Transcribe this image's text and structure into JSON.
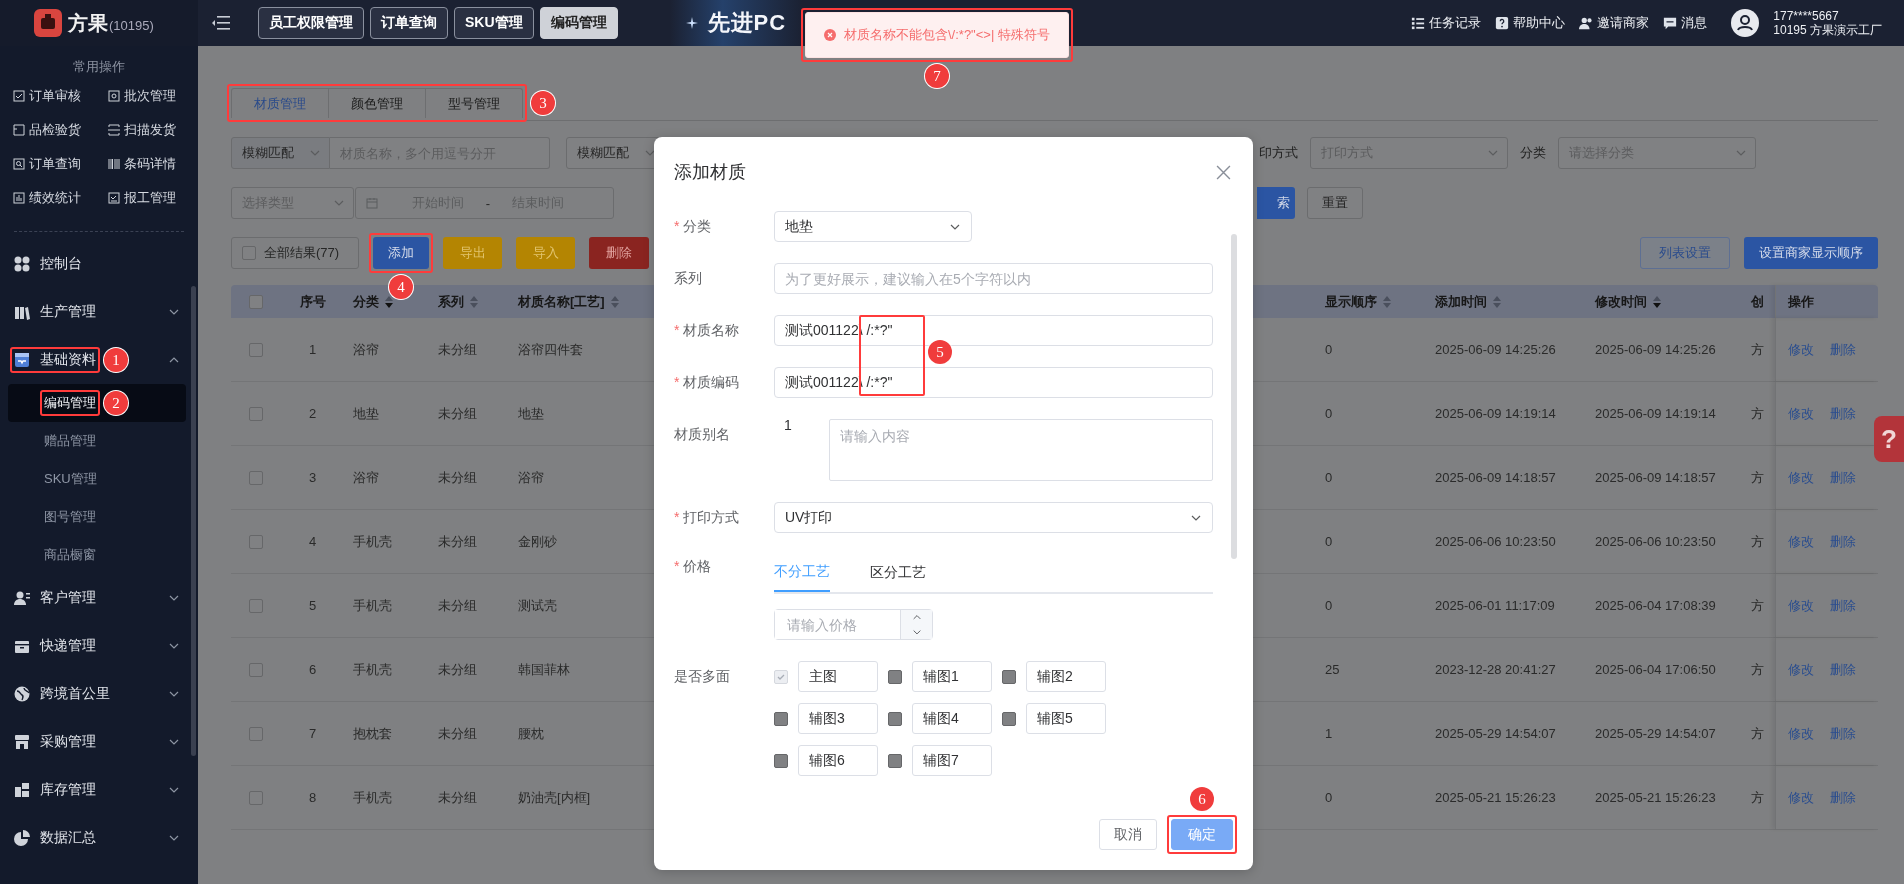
{
  "app": {
    "name": "方果",
    "id": "(10195)"
  },
  "topbar": {
    "nav": [
      {
        "label": "员工权限管理",
        "selected": false
      },
      {
        "label": "订单查询",
        "selected": false
      },
      {
        "label": "SKU管理",
        "selected": false
      },
      {
        "label": "编码管理",
        "selected": true
      }
    ],
    "banner_text": "先进PC",
    "tools": [
      {
        "label": "任务记录"
      },
      {
        "label": "帮助中心"
      },
      {
        "label": "邀请商家"
      },
      {
        "label": "消息"
      }
    ],
    "user": {
      "phone": "177****5667",
      "factory": "10195 方果演示工厂"
    }
  },
  "toast": {
    "message": "材质名称不能包含\\/:*?\"<>| 特殊符号",
    "annotation": "7"
  },
  "sidebar": {
    "quick_title": "常用操作",
    "quick_actions": [
      {
        "label": "订单审核"
      },
      {
        "label": "批次管理"
      },
      {
        "label": "品检验货"
      },
      {
        "label": "扫描发货"
      },
      {
        "label": "订单查询"
      },
      {
        "label": "条码详情"
      },
      {
        "label": "绩效统计"
      },
      {
        "label": "报工管理"
      }
    ],
    "menu": [
      {
        "label": "控制台"
      },
      {
        "label": "生产管理",
        "expanded": false
      },
      {
        "label": "基础资料",
        "expanded": true,
        "annotation": "1",
        "children": [
          {
            "label": "编码管理",
            "selected": true,
            "annotation": "2"
          },
          {
            "label": "赠品管理",
            "selected": false
          },
          {
            "label": "SKU管理",
            "selected": false
          },
          {
            "label": "图号管理",
            "selected": false
          },
          {
            "label": "商品橱窗",
            "selected": false
          }
        ]
      },
      {
        "label": "客户管理",
        "expanded": false
      },
      {
        "label": "快递管理",
        "expanded": false
      },
      {
        "label": "跨境首公里",
        "expanded": false
      },
      {
        "label": "采购管理",
        "expanded": false
      },
      {
        "label": "库存管理",
        "expanded": false
      },
      {
        "label": "数据汇总",
        "expanded": false
      }
    ]
  },
  "tabs": {
    "annotation": "3",
    "items": [
      {
        "label": "材质管理",
        "selected": true
      },
      {
        "label": "颜色管理",
        "selected": false
      },
      {
        "label": "型号管理",
        "selected": false
      }
    ]
  },
  "filters": {
    "match_select": "模糊匹配",
    "name_placeholder": "材质名称，多个用逗号分开",
    "match_select_2": "模糊匹配",
    "print_label": "印方式",
    "print_placeholder": "打印方式",
    "category_label": "分类",
    "category_placeholder": "请选择分类",
    "type_placeholder": "选择类型",
    "date_start": "开始时间",
    "date_separator": "-",
    "date_end": "结束时间",
    "search_button": "索",
    "reset_button": "重置"
  },
  "actions": {
    "all_results": {
      "label": "全部结果(77)",
      "checked": false
    },
    "buttons": [
      {
        "label": "添加",
        "kind": "primary",
        "annotation": "4"
      },
      {
        "label": "导出",
        "kind": "warning"
      },
      {
        "label": "导入",
        "kind": "warning"
      },
      {
        "label": "删除",
        "kind": "danger"
      }
    ],
    "right_buttons": [
      {
        "label": "列表设置",
        "kind": "plain"
      },
      {
        "label": "设置商家显示顺序",
        "kind": "primary"
      }
    ]
  },
  "table": {
    "header_checked": false,
    "columns": [
      {
        "label": "序号"
      },
      {
        "label": "分类",
        "sorted_desc": true
      },
      {
        "label": "系列",
        "sorted_desc": false
      },
      {
        "label": "材质名称[工艺]",
        "sorted_desc": false
      },
      {
        "label": "显示顺序",
        "sorted_desc": false
      },
      {
        "label": "添加时间",
        "sorted_desc": false
      },
      {
        "label": "修改时间",
        "sorted_desc": true
      },
      {
        "label": "创"
      },
      {
        "label": "操作"
      }
    ],
    "rows": [
      {
        "checked": false,
        "cells": [
          "1",
          "浴帘",
          "未分组",
          "浴帘四件套",
          "0",
          "2025-06-09 14:25:26",
          "2025-06-09 14:25:26",
          "方"
        ],
        "actions": [
          "修改",
          "删除"
        ]
      },
      {
        "checked": false,
        "cells": [
          "2",
          "地垫",
          "未分组",
          "地垫",
          "0",
          "2025-06-09 14:19:14",
          "2025-06-09 14:19:14",
          "方"
        ],
        "actions": [
          "修改",
          "删除"
        ]
      },
      {
        "checked": false,
        "cells": [
          "3",
          "浴帘",
          "未分组",
          "浴帘",
          "0",
          "2025-06-09 14:18:57",
          "2025-06-09 14:18:57",
          "方"
        ],
        "actions": [
          "修改",
          "删除"
        ]
      },
      {
        "checked": false,
        "cells": [
          "4",
          "手机壳",
          "未分组",
          "金刚砂",
          "0",
          "2025-06-06 10:23:50",
          "2025-06-06 10:23:50",
          "方"
        ],
        "actions": [
          "修改",
          "删除"
        ]
      },
      {
        "checked": false,
        "cells": [
          "5",
          "手机壳",
          "未分组",
          "测试壳",
          "0",
          "2025-06-01 11:17:09",
          "2025-06-04 17:08:39",
          "方"
        ],
        "actions": [
          "修改",
          "删除"
        ]
      },
      {
        "checked": false,
        "cells": [
          "6",
          "手机壳",
          "未分组",
          "韩国菲林",
          "25",
          "2023-12-28 20:41:27",
          "2025-06-04 17:06:50",
          "方"
        ],
        "actions": [
          "修改",
          "删除"
        ]
      },
      {
        "checked": false,
        "cells": [
          "7",
          "抱枕套",
          "未分组",
          "腰枕",
          "1",
          "2025-05-29 14:54:07",
          "2025-05-29 14:54:07",
          "方"
        ],
        "actions": [
          "修改",
          "删除"
        ]
      },
      {
        "checked": false,
        "cells": [
          "8",
          "手机壳",
          "未分组",
          "奶油壳[内框]",
          "0",
          "2025-05-21 15:26:23",
          "2025-05-21 15:26:23",
          "方"
        ],
        "actions": [
          "修改",
          "删除"
        ]
      }
    ]
  },
  "modal": {
    "title": "添加材质",
    "annotation": "5",
    "fields": [
      {
        "kind": "select",
        "required_mark": "*",
        "label": "分类",
        "value": "地垫"
      },
      {
        "kind": "text",
        "label": "系列",
        "placeholder": "为了更好展示，建议输入在5个字符以内"
      },
      {
        "kind": "text",
        "required_mark": "*",
        "label": "材质名称",
        "value": "测试001122\\ /:*?\""
      },
      {
        "kind": "text",
        "required_mark": "*",
        "label": "材质编码",
        "value": "测试001122\\ /:*?\""
      },
      {
        "kind": "alias",
        "label": "材质别名",
        "index": "1",
        "placeholder": "请输入内容"
      },
      {
        "kind": "select",
        "required_mark": "*",
        "label": "打印方式",
        "value": "UV打印"
      },
      {
        "kind": "price",
        "required_mark": "*",
        "label": "价格",
        "tabs": [
          {
            "label": "不分工艺",
            "selected": true
          },
          {
            "label": "区分工艺",
            "selected": false
          }
        ],
        "placeholder": "请输入价格"
      },
      {
        "kind": "faces",
        "label": "是否多面",
        "options": [
          {
            "value": "主图",
            "checked": true,
            "disabled": true
          },
          {
            "value": "辅图1",
            "checked": false,
            "disabled": false
          },
          {
            "value": "辅图2",
            "checked": false,
            "disabled": false
          },
          {
            "value": "辅图3",
            "checked": false,
            "disabled": false
          },
          {
            "value": "辅图4",
            "checked": false,
            "disabled": false
          },
          {
            "value": "辅图5",
            "checked": false,
            "disabled": false
          },
          {
            "value": "辅图6",
            "checked": false,
            "disabled": false
          },
          {
            "value": "辅图7",
            "checked": false,
            "disabled": false
          }
        ]
      }
    ],
    "buttons": [
      {
        "label": "取消",
        "kind": "plain"
      },
      {
        "label": "确定",
        "kind": "primary",
        "annotation": "6"
      }
    ]
  },
  "help_tab": "?"
}
